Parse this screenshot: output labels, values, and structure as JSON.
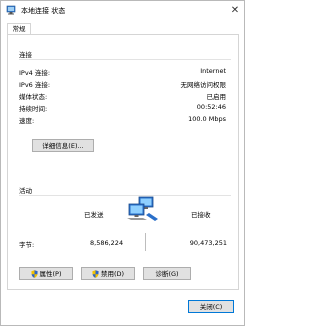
{
  "window": {
    "title": "本地连接 状态"
  },
  "tabs": [
    {
      "label": "常规"
    }
  ],
  "connection": {
    "section_label": "连接",
    "rows": [
      {
        "label": "IPv4 连接:",
        "value": "Internet"
      },
      {
        "label": "IPv6 连接:",
        "value": "无网络访问权限"
      },
      {
        "label": "媒体状态:",
        "value": "已启用"
      },
      {
        "label": "持续时间:",
        "value": "00:52:46"
      },
      {
        "label": "速度:",
        "value": "100.0 Mbps"
      }
    ],
    "details_button": "详细信息(E)..."
  },
  "activity": {
    "section_label": "活动",
    "sent_label": "已发送",
    "received_label": "已接收",
    "bytes_label": "字节:",
    "bytes_sent": "8,586,224",
    "bytes_received": "90,473,251"
  },
  "buttons": {
    "properties": "属性(P)",
    "disable": "禁用(D)",
    "diagnose": "诊断(G)",
    "close": "关闭(C)"
  },
  "icons": {
    "app": "network-icon",
    "network_activity": "network-activity-icon",
    "shield": "uac-shield-icon",
    "close": "close-icon"
  }
}
